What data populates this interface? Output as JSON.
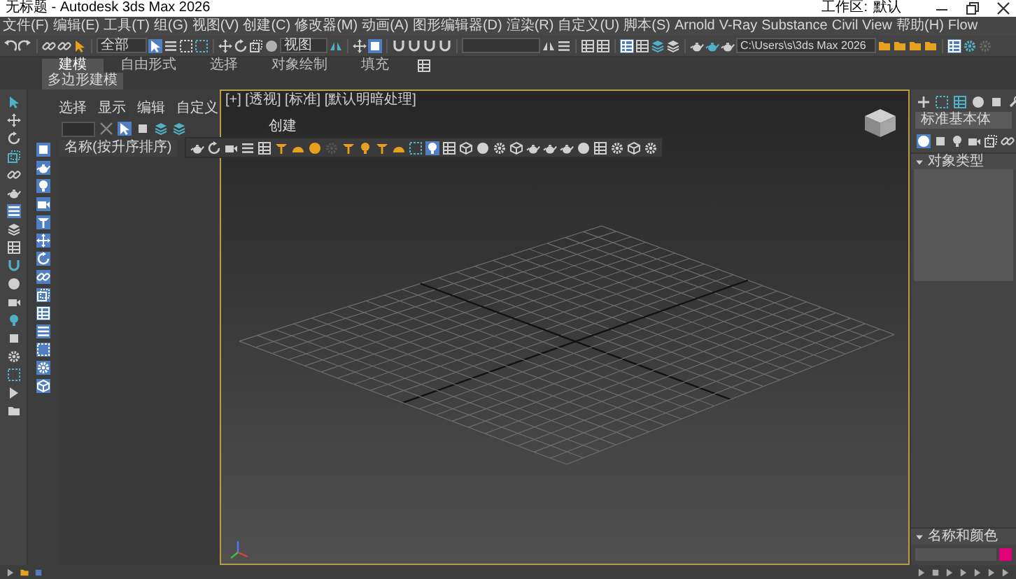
{
  "window": {
    "title": "无标题 - Autodesk 3ds Max 2026",
    "workspace_label": "工作区:",
    "workspace": "默认"
  },
  "menu": [
    "文件(F)",
    "编辑(E)",
    "工具(T)",
    "组(G)",
    "视图(V)",
    "创建(C)",
    "修改器(M)",
    "动画(A)",
    "图形编辑器(D)",
    "渲染(R)",
    "自定义(U)",
    "脚本(S)",
    "Arnold",
    "V-Ray",
    "Substance",
    "Civil View",
    "帮助(H)",
    "Flow"
  ],
  "toolbar": {
    "selection_filter": "全部",
    "reference_coordinate": "视图",
    "project_path": "C:\\Users\\s\\3ds Max 2026"
  },
  "ribbon": {
    "tabs": [
      {
        "label": "建模",
        "selected": true
      },
      {
        "label": "自由形式",
        "selected": false
      },
      {
        "label": "选择",
        "selected": false
      },
      {
        "label": "对象绘制",
        "selected": false
      },
      {
        "label": "填充",
        "selected": false
      }
    ],
    "panel": "多边形建模"
  },
  "scene_explorer": {
    "tabs": [
      "选择",
      "显示",
      "编辑",
      "自定义"
    ],
    "column": "名称(按升序排序)"
  },
  "tooltip": "创建",
  "viewport": {
    "label": "[+] [透视] [标准] [默认明暗处理]"
  },
  "command_panel": {
    "dropdown": "标准基本体",
    "rollouts": [
      {
        "title": "对象类型",
        "expanded": true
      },
      {
        "title": "名称和颜色",
        "expanded": true
      }
    ]
  }
}
